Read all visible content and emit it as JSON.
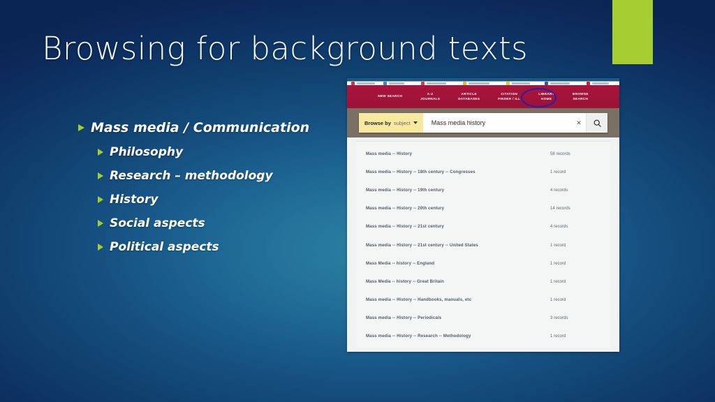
{
  "slide": {
    "title": "Browsing for background texts",
    "background_center_color": "#2b7fa4",
    "background_edge_color": "#0b2553",
    "accent_green": "#a5ce33",
    "bullet_arrow_color": "#9fd12e"
  },
  "bullets": [
    {
      "level": 1,
      "text": "Mass media / Communication"
    },
    {
      "level": 2,
      "text": "Philosophy"
    },
    {
      "level": 2,
      "text": "Research – methodology"
    },
    {
      "level": 2,
      "text": "History"
    },
    {
      "level": 2,
      "text": "Social aspects"
    },
    {
      "level": 2,
      "text": "Political aspects"
    }
  ],
  "screenshot": {
    "nav": {
      "bar_color": "#a5123a",
      "items": [
        {
          "label": "NEW SEARCH",
          "highlighted": false
        },
        {
          "label": "A-Z\nJOURNALS",
          "highlighted": false
        },
        {
          "label": "ARTICLE\nDATABASES",
          "highlighted": false
        },
        {
          "label": "CITATION\nFINDER / ILL",
          "highlighted": false
        },
        {
          "label": "LIBRARY\nHOME",
          "highlighted": false
        },
        {
          "label": "BROWSE\nSEARCH",
          "highlighted": true
        }
      ],
      "annotation_circle_color": "#2020b4"
    },
    "search": {
      "browse_by_label": "Browse by",
      "browse_by_value": "subject",
      "query": "Mass media history",
      "clear_icon": "close-x-icon",
      "search_icon": "magnifier-icon",
      "dropdown_bg": "#f7e9a0"
    },
    "results": [
      {
        "subject": "Mass media -- History",
        "count": "58 records"
      },
      {
        "subject": "Mass media -- History -- 18th century -- Congresses",
        "count": "1 record"
      },
      {
        "subject": "Mass media -- History -- 19th century",
        "count": "4 records"
      },
      {
        "subject": "Mass media -- History -- 20th century",
        "count": "14 records"
      },
      {
        "subject": "Mass media -- History -- 21st century",
        "count": "4 records"
      },
      {
        "subject": "Mass media -- History -- 21st century -- United States",
        "count": "1 record"
      },
      {
        "subject": "Mass Media -- history -- England",
        "count": "1 record"
      },
      {
        "subject": "Mass Media -- history -- Great Britain",
        "count": "1 record"
      },
      {
        "subject": "Mass media -- History -- Handbooks, manuals, etc",
        "count": "1 record"
      },
      {
        "subject": "Mass media -- History -- Periodicals",
        "count": "3 records"
      },
      {
        "subject": "Mass media -- History -- Research -- Methodology",
        "count": "1 record"
      }
    ]
  }
}
